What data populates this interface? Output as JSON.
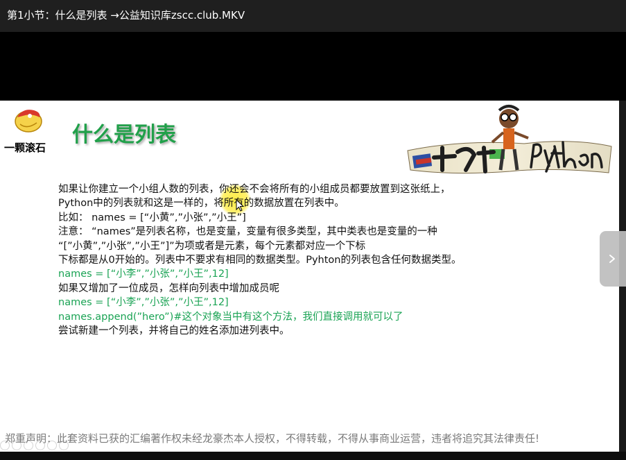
{
  "window": {
    "title": "第1小节：什么是列表 →公益知识库zscc.club.MKV"
  },
  "slide": {
    "logo_label": "一颗滚石",
    "heading": "什么是列表",
    "banner_text": "一起学Python",
    "lines": [
      {
        "text": "如果让你建立一个小组人数的列表，你还会不会将所有的小组成员都要放置到这张纸上，",
        "style": "normal"
      },
      {
        "text": "Python中的列表就和这是一样的，将所有的数据放置在列表中。",
        "style": "normal"
      },
      {
        "text": "比如： names = [“小黄”,”小张”,”小王”]",
        "style": "normal"
      },
      {
        "text": "注意： “names”是列表名称，也是变量，变量有很多类型，其中类表也是变量的一种",
        "style": "normal"
      },
      {
        "text": "“[”小黄”,”小张”,”小王”]”为项或者是元素，每个元素都对应一个下标",
        "style": "normal"
      },
      {
        "text": "下标都是从0开始的。列表中不要求有相同的数据类型。Pyhton的列表包含任何数据类型。",
        "style": "normal"
      },
      {
        "text": "names = [“小李”,”小张”,”小王”,12]",
        "style": "green"
      },
      {
        "text": "如果又增加了一位成员，怎样向列表中增加成员呢",
        "style": "normal"
      },
      {
        "text": "names = [“小李”,”小张”,”小王”,12]",
        "style": "green"
      },
      {
        "text": "names.append(”hero”)#这个对象当中有这个方法，我们直接调用就可以了",
        "style": "green"
      },
      {
        "text": "尝试新建一个列表，并将自己的姓名添加进列表中。",
        "style": "normal"
      }
    ],
    "disclaimer": "郑重声明：此套资料已获的汇编著作权未经龙豪杰本人授权，不得转载，不得从事商业运营，违者将追究其法律责任!"
  },
  "colors": {
    "heading": "#21a04a",
    "code_green": "#1aa354",
    "titlebar": "#1f1f1f",
    "highlight": "#ffec3c"
  },
  "icons": {
    "logo": "rolling-stone-logo-icon",
    "next": "chevron-right-icon",
    "cursor": "mouse-pointer-icon"
  }
}
